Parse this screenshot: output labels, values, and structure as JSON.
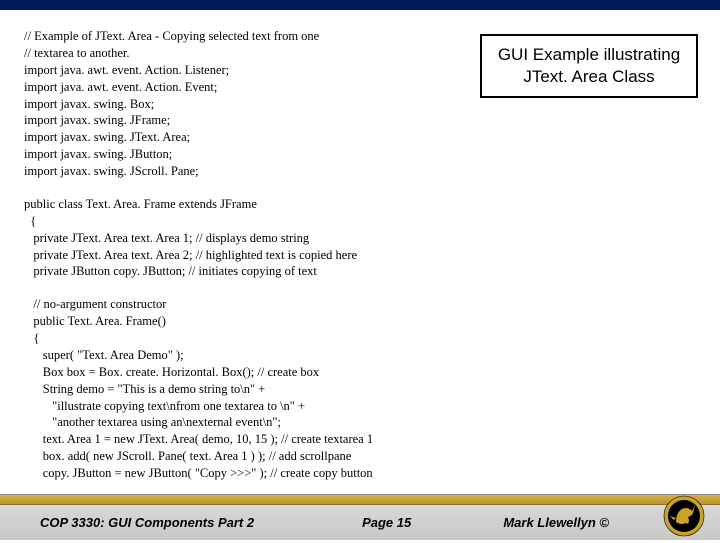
{
  "callout": {
    "line1": "GUI Example illustrating",
    "line2": "JText. Area Class"
  },
  "code": {
    "block1": "// Example of JText. Area - Copying selected text from one\n// textarea to another.\nimport java. awt. event. Action. Listener;\nimport java. awt. event. Action. Event;\nimport javax. swing. Box;\nimport javax. swing. JFrame;\nimport javax. swing. JText. Area;\nimport javax. swing. JButton;\nimport javax. swing. JScroll. Pane;",
    "block2": "public class Text. Area. Frame extends JFrame\n  {\n   private JText. Area text. Area 1; // displays demo string\n   private JText. Area text. Area 2; // highlighted text is copied here\n   private JButton copy. JButton; // initiates copying of text",
    "block3": "   // no-argument constructor\n   public Text. Area. Frame()\n   {\n      super( \"Text. Area Demo\" );\n      Box box = Box. create. Horizontal. Box(); // create box\n      String demo = \"This is a demo string to\\n\" +\n         \"illustrate copying text\\nfrom one textarea to \\n\" +\n         \"another textarea using an\\nexternal event\\n\";\n      text. Area 1 = new JText. Area( demo, 10, 15 ); // create textarea 1\n      box. add( new JScroll. Pane( text. Area 1 ) ); // add scrollpane\n      copy. JButton = new JButton( \"Copy >>>\" ); // create copy button"
  },
  "footer": {
    "course": "COP 3330: GUI Components Part 2",
    "page": "Page 15",
    "author": "Mark Llewellyn ©"
  }
}
